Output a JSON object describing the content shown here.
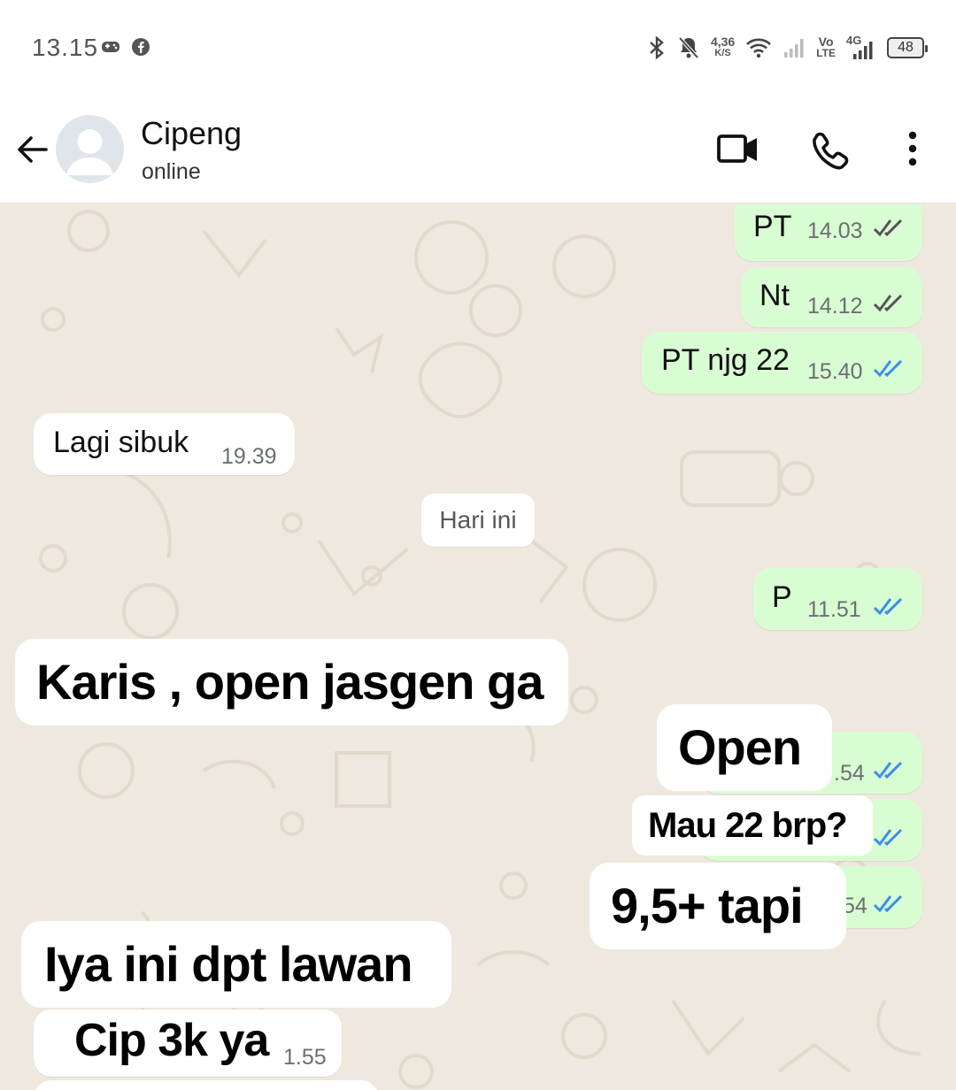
{
  "status_bar": {
    "time": "13.15",
    "net_speed_top": "4,36",
    "net_speed_bottom": "K/S",
    "volte_top": "Vo",
    "volte_bottom": "LTE",
    "network": "4G",
    "battery": "48"
  },
  "header": {
    "contact_name": "Cipeng",
    "contact_status": "online"
  },
  "day_separator": "Hari ini",
  "messages": [
    {
      "text": "PT",
      "time": "14.03",
      "dir": "out",
      "read": false
    },
    {
      "text": "Nt",
      "time": "14.12",
      "dir": "out",
      "read": false
    },
    {
      "text": "PT njg 22",
      "time": "15.40",
      "dir": "out",
      "read": true
    },
    {
      "text": "Lagi sibuk",
      "time": "19.39",
      "dir": "in"
    },
    {
      "text": "P",
      "time": "11.51",
      "dir": "out",
      "read": true
    },
    {
      "time": ".54",
      "dir": "out",
      "read": true
    },
    {
      "time": "54",
      "dir": "out",
      "read": true
    },
    {
      "time": "1.55",
      "dir": "in"
    }
  ],
  "stickers": [
    "Karis , open jasgen ga",
    "Open",
    "Mau 22 brp?",
    "9,5+ tapi",
    "Iya ini dpt lawan",
    "Cip 3k ya"
  ],
  "colors": {
    "outgoing_bubble": "#d9fdd3",
    "incoming_bubble": "#ffffff",
    "read_tick": "#3a8ee6",
    "unread_tick": "#555555",
    "chat_background": "#efe8df"
  }
}
